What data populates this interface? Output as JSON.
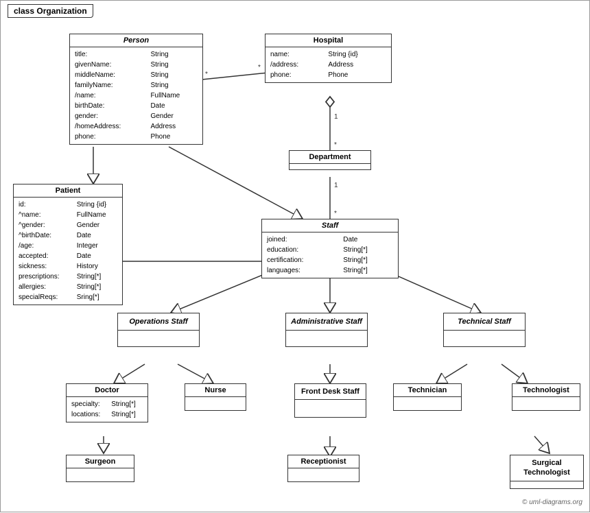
{
  "title": "class Organization",
  "classes": {
    "person": {
      "name": "Person",
      "italic": true,
      "attrs": [
        [
          "title:",
          "String"
        ],
        [
          "givenName:",
          "String"
        ],
        [
          "middleName:",
          "String"
        ],
        [
          "familyName:",
          "String"
        ],
        [
          "/name:",
          "FullName"
        ],
        [
          "birthDate:",
          "Date"
        ],
        [
          "gender:",
          "Gender"
        ],
        [
          "/homeAddress:",
          "Address"
        ],
        [
          "phone:",
          "Phone"
        ]
      ]
    },
    "hospital": {
      "name": "Hospital",
      "italic": false,
      "attrs": [
        [
          "name:",
          "String {id}"
        ],
        [
          "/address:",
          "Address"
        ],
        [
          "phone:",
          "Phone"
        ]
      ]
    },
    "department": {
      "name": "Department",
      "italic": false,
      "attrs": []
    },
    "staff": {
      "name": "Staff",
      "italic": true,
      "attrs": [
        [
          "joined:",
          "Date"
        ],
        [
          "education:",
          "String[*]"
        ],
        [
          "certification:",
          "String[*]"
        ],
        [
          "languages:",
          "String[*]"
        ]
      ]
    },
    "patient": {
      "name": "Patient",
      "italic": false,
      "attrs": [
        [
          "id:",
          "String {id}"
        ],
        [
          "^name:",
          "FullName"
        ],
        [
          "^gender:",
          "Gender"
        ],
        [
          "^birthDate:",
          "Date"
        ],
        [
          "/age:",
          "Integer"
        ],
        [
          "accepted:",
          "Date"
        ],
        [
          "sickness:",
          "History"
        ],
        [
          "prescriptions:",
          "String[*]"
        ],
        [
          "allergies:",
          "String[*]"
        ],
        [
          "specialReqs:",
          "Sring[*]"
        ]
      ]
    },
    "operations_staff": {
      "name": "Operations Staff",
      "italic": true
    },
    "administrative_staff": {
      "name": "Administrative Staff",
      "italic": true
    },
    "technical_staff": {
      "name": "Technical Staff",
      "italic": true
    },
    "doctor": {
      "name": "Doctor",
      "italic": false,
      "attrs": [
        [
          "specialty:",
          "String[*]"
        ],
        [
          "locations:",
          "String[*]"
        ]
      ]
    },
    "nurse": {
      "name": "Nurse",
      "italic": false,
      "attrs": []
    },
    "front_desk_staff": {
      "name": "Front Desk Staff",
      "italic": false,
      "attrs": []
    },
    "technician": {
      "name": "Technician",
      "italic": false,
      "attrs": []
    },
    "technologist": {
      "name": "Technologist",
      "italic": false,
      "attrs": []
    },
    "surgeon": {
      "name": "Surgeon",
      "italic": false,
      "attrs": []
    },
    "receptionist": {
      "name": "Receptionist",
      "italic": false,
      "attrs": []
    },
    "surgical_technologist": {
      "name": "Surgical Technologist",
      "italic": false,
      "attrs": []
    }
  },
  "copyright": "© uml-diagrams.org"
}
